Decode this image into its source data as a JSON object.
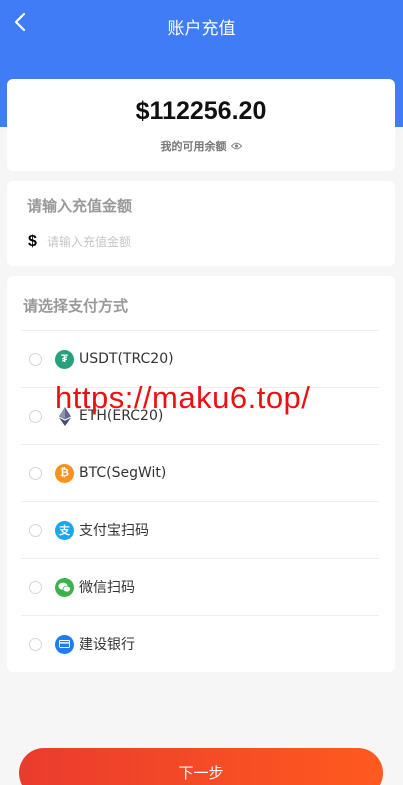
{
  "header": {
    "title": "账户充值",
    "back_icon": "chevron-left-icon"
  },
  "balance": {
    "value": "$112256.20",
    "label": "我的可用余额",
    "eye_icon": "eye-icon"
  },
  "amount": {
    "title": "请输入充值金额",
    "currency_symbol": "$",
    "placeholder": "请输入充值金额",
    "value": ""
  },
  "payment": {
    "title": "请选择支付方式",
    "methods": [
      {
        "label": "USDT(TRC20)",
        "icon": "tether-icon",
        "color": "#26a17b"
      },
      {
        "label": "ETH(ERC20)",
        "icon": "ethereum-icon",
        "color": "#62688f"
      },
      {
        "label": "BTC(SegWit)",
        "icon": "bitcoin-icon",
        "color": "#f7931a"
      },
      {
        "label": "支付宝扫码",
        "icon": "alipay-icon",
        "color": "#1aa7ec"
      },
      {
        "label": "微信扫码",
        "icon": "wechat-icon",
        "color": "#3bb34a"
      },
      {
        "label": "建设银行",
        "icon": "bank-card-icon",
        "color": "#1e7cf5"
      }
    ]
  },
  "watermark": "https://maku6.top/",
  "next_button": "下一步",
  "colors": {
    "header": "#3f7cf6",
    "button_start": "#ea3b2e",
    "button_end": "#ff5a1f",
    "watermark": "#ee1010"
  }
}
